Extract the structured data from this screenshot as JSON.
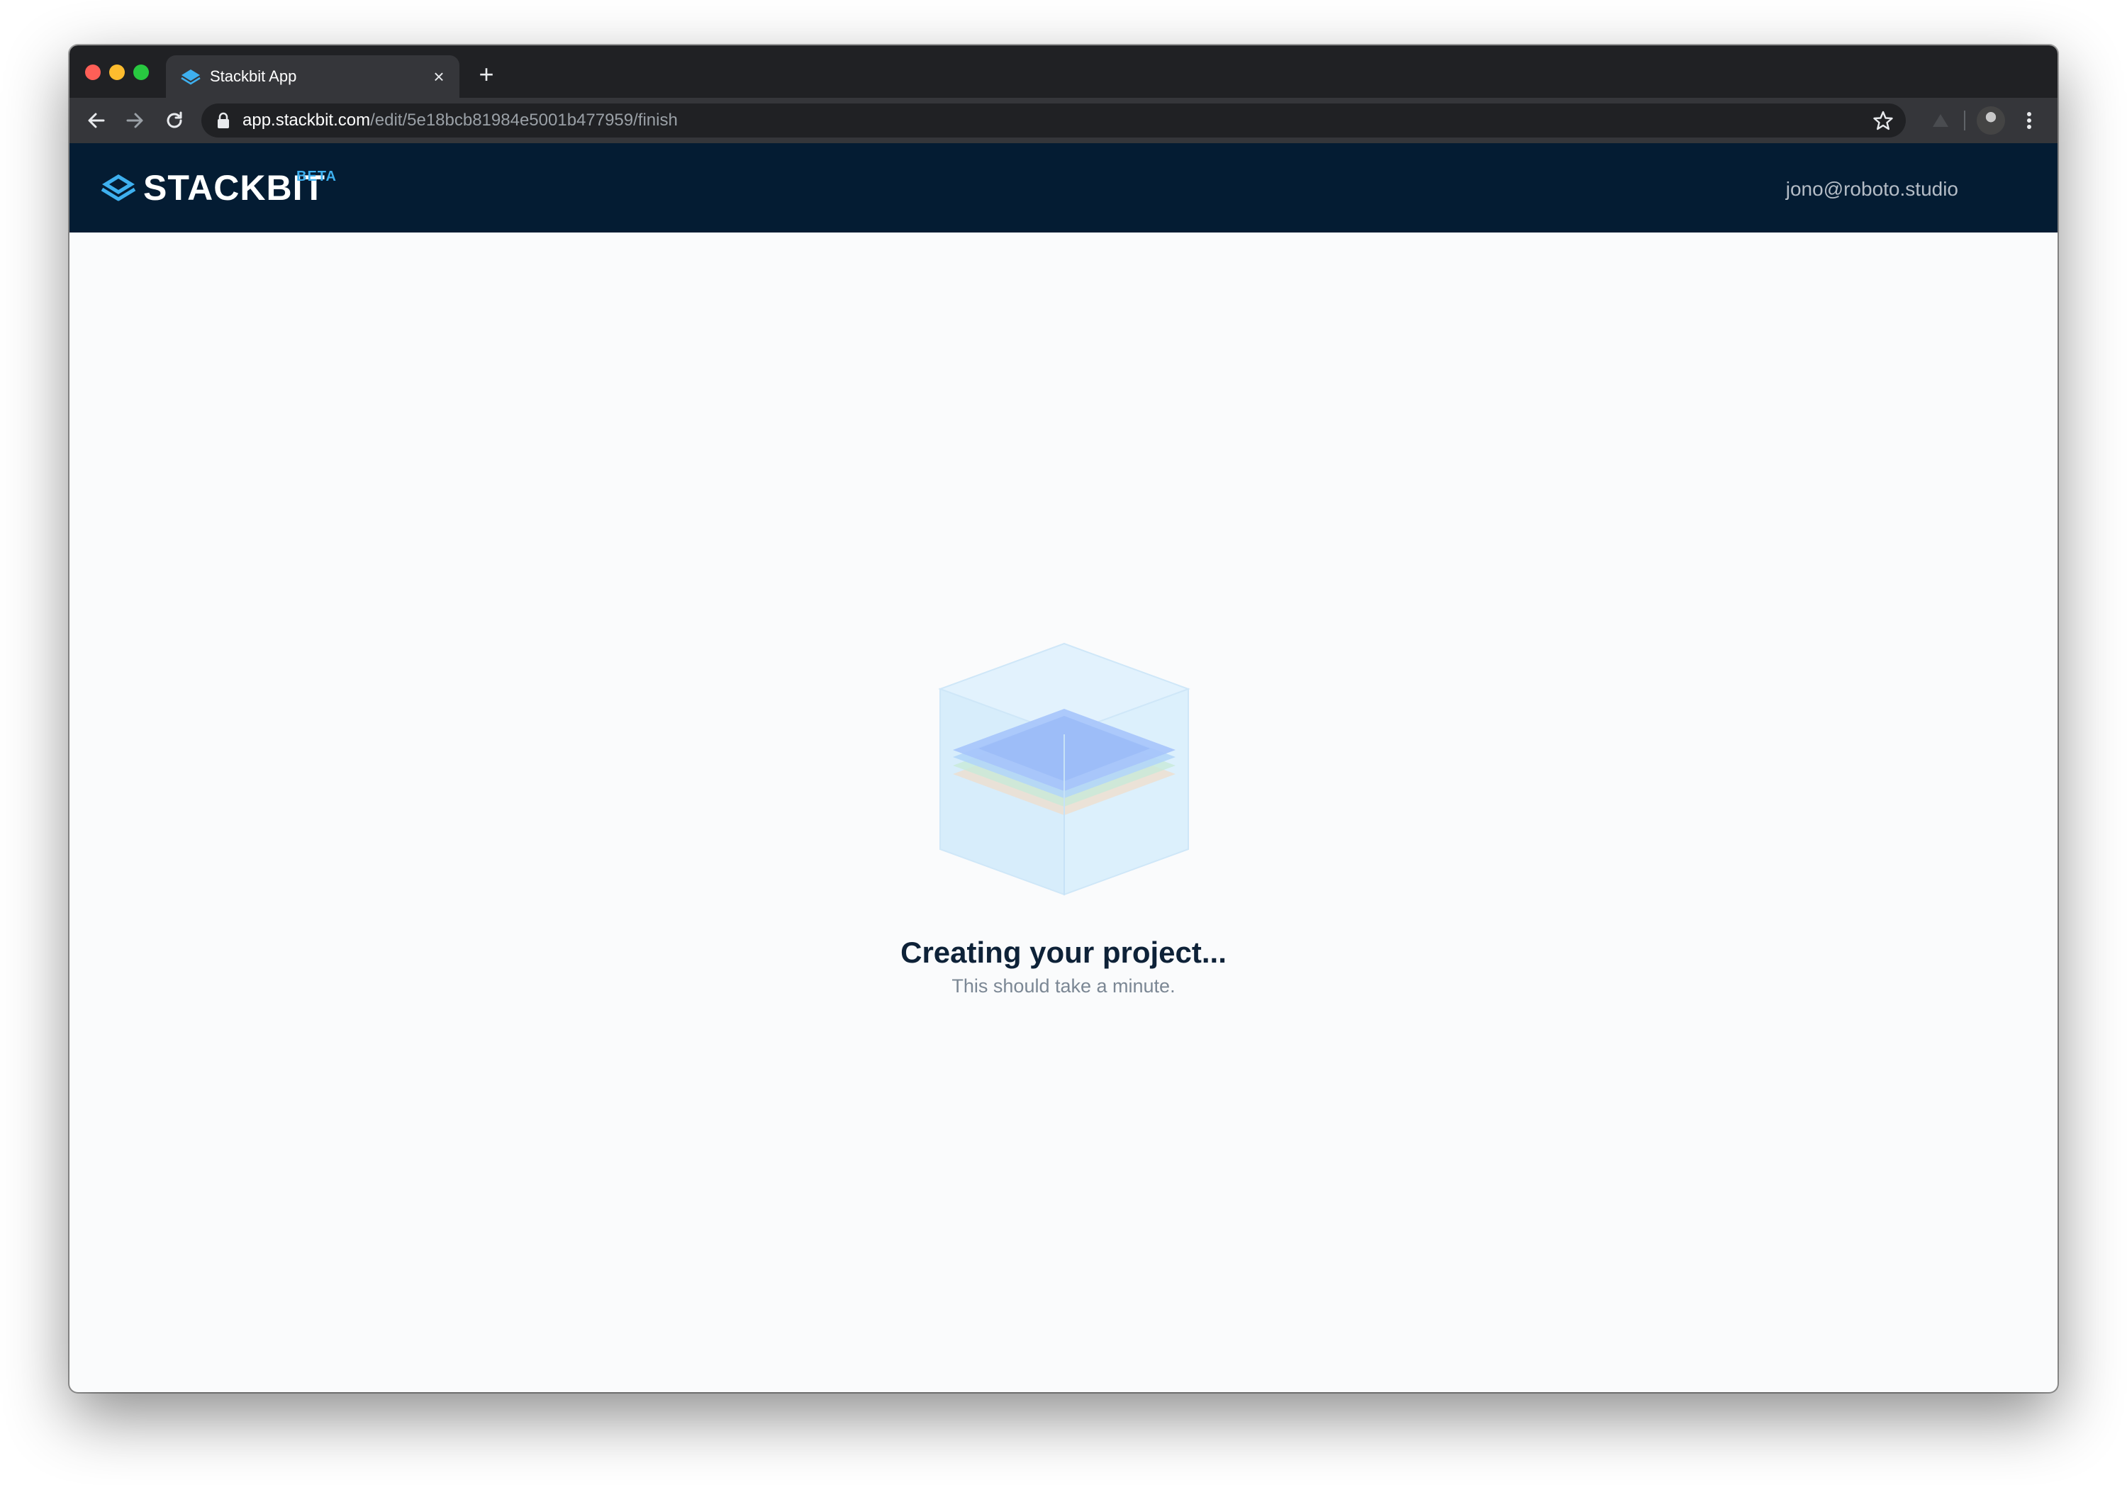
{
  "browser": {
    "tab": {
      "title": "Stackbit App",
      "close_glyph": "×"
    },
    "new_tab_glyph": "+",
    "url": {
      "host": "app.stackbit.com",
      "path": "/edit/5e18bcb81984e5001b477959/finish"
    }
  },
  "header": {
    "brand": "STACKBIT",
    "badge": "BETA",
    "user_email": "jono@roboto.studio"
  },
  "main": {
    "title": "Creating your project...",
    "subtitle": "This should take a minute."
  },
  "colors": {
    "header_bg": "#041c33",
    "accent": "#3eb0ef",
    "chat_button": "#3ba9f0",
    "page_bg": "#fafbfc"
  },
  "icons": {
    "tab_favicon": "stackbit-layers-icon",
    "back": "arrow-left-icon",
    "forward": "arrow-right-icon",
    "reload": "reload-icon",
    "lock": "lock-icon",
    "bookmark": "star-icon",
    "menu": "more-vert-icon",
    "loader": "layered-cube-illustration",
    "chat": "chat-icon"
  }
}
